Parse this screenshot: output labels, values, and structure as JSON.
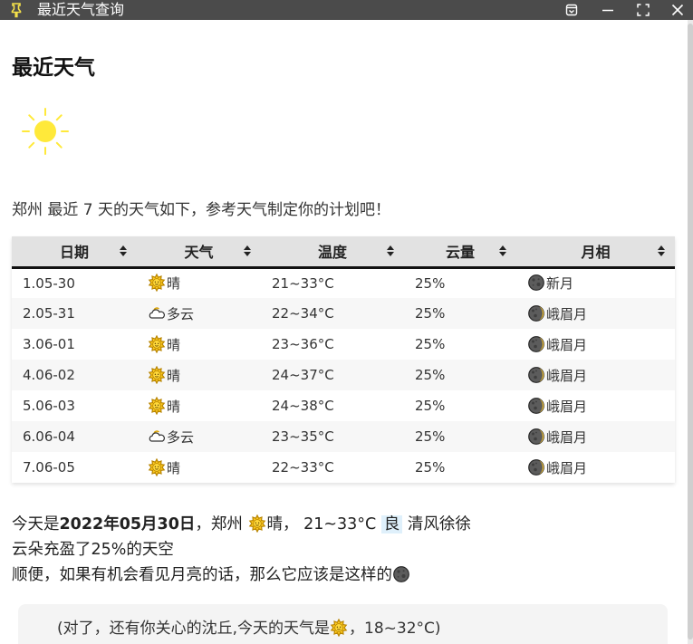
{
  "window": {
    "title": "最近天气查询"
  },
  "page": {
    "heading": "最近天气",
    "intro": "郑州 最近 7 天的天气如下，参考天气制定你的计划吧！"
  },
  "table": {
    "headers": [
      "日期",
      "天气",
      "温度",
      "云量",
      "月相"
    ],
    "rows": [
      {
        "date": "1.05-30",
        "weather": "晴",
        "weather_icon": "sunny-icon",
        "temp": "21~33°C",
        "cloud": "25%",
        "moon": "新月",
        "moon_icon": "new-moon-icon"
      },
      {
        "date": "2.05-31",
        "weather": "多云",
        "weather_icon": "cloudy-icon",
        "temp": "22~34°C",
        "cloud": "25%",
        "moon": "峨眉月",
        "moon_icon": "crescent-moon-icon"
      },
      {
        "date": "3.06-01",
        "weather": "晴",
        "weather_icon": "sunny-icon",
        "temp": "23~36°C",
        "cloud": "25%",
        "moon": "峨眉月",
        "moon_icon": "crescent-moon-icon"
      },
      {
        "date": "4.06-02",
        "weather": "晴",
        "weather_icon": "sunny-icon",
        "temp": "24~37°C",
        "cloud": "25%",
        "moon": "峨眉月",
        "moon_icon": "crescent-moon-icon"
      },
      {
        "date": "5.06-03",
        "weather": "晴",
        "weather_icon": "sunny-icon",
        "temp": "24~38°C",
        "cloud": "25%",
        "moon": "峨眉月",
        "moon_icon": "crescent-moon-icon"
      },
      {
        "date": "6.06-04",
        "weather": "多云",
        "weather_icon": "cloudy-icon",
        "temp": "23~35°C",
        "cloud": "25%",
        "moon": "峨眉月",
        "moon_icon": "crescent-moon-icon"
      },
      {
        "date": "7.06-05",
        "weather": "晴",
        "weather_icon": "sunny-icon",
        "temp": "22~33°C",
        "cloud": "25%",
        "moon": "峨眉月",
        "moon_icon": "crescent-moon-icon"
      }
    ]
  },
  "summary": {
    "prefix": "今天是",
    "date": "2022年05月30日",
    "city": "，郑州 ",
    "weather": "晴，",
    "temp": " 21~33°C ",
    "air_quality": "良",
    "wind": " 清风徐徐",
    "line2": "云朵充盈了25%的天空",
    "line3": "顺便，如果有机会看见月亮的话，那么它应该是这样的"
  },
  "note": {
    "text_before": "(对了，还有你关心的沈丘,今天的天气是",
    "text_after": "，18~32°C)"
  },
  "colors": {
    "titlebar": "#4b4b4b",
    "pin": "#f5e14a",
    "sun": "#ffe93a",
    "header_bg": "#e2e2e2",
    "air_quality_bg": "#dff0fb"
  }
}
